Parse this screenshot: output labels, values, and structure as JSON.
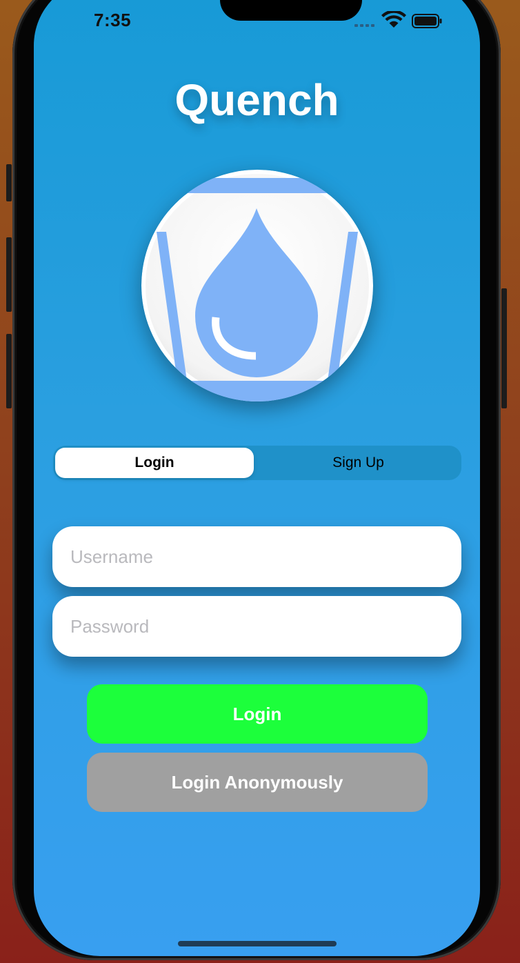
{
  "status_bar": {
    "time": "7:35"
  },
  "app": {
    "title": "Quench",
    "logo_icon": "water-drop-glass-icon"
  },
  "auth_mode_picker": {
    "options": [
      "Login",
      "Sign Up"
    ],
    "selected": "Login"
  },
  "form": {
    "username_placeholder": "Username",
    "username_value": "",
    "password_placeholder": "Password",
    "password_value": ""
  },
  "buttons": {
    "login_label": "Login",
    "login_anonymously_label": "Login Anonymously"
  },
  "colors": {
    "background_top": "#179ad6",
    "background_bottom": "#389ff0",
    "login_button": "#1cff3b",
    "anonymous_button": "#a0a0a0",
    "logo_blue": "#7fb2f7"
  }
}
